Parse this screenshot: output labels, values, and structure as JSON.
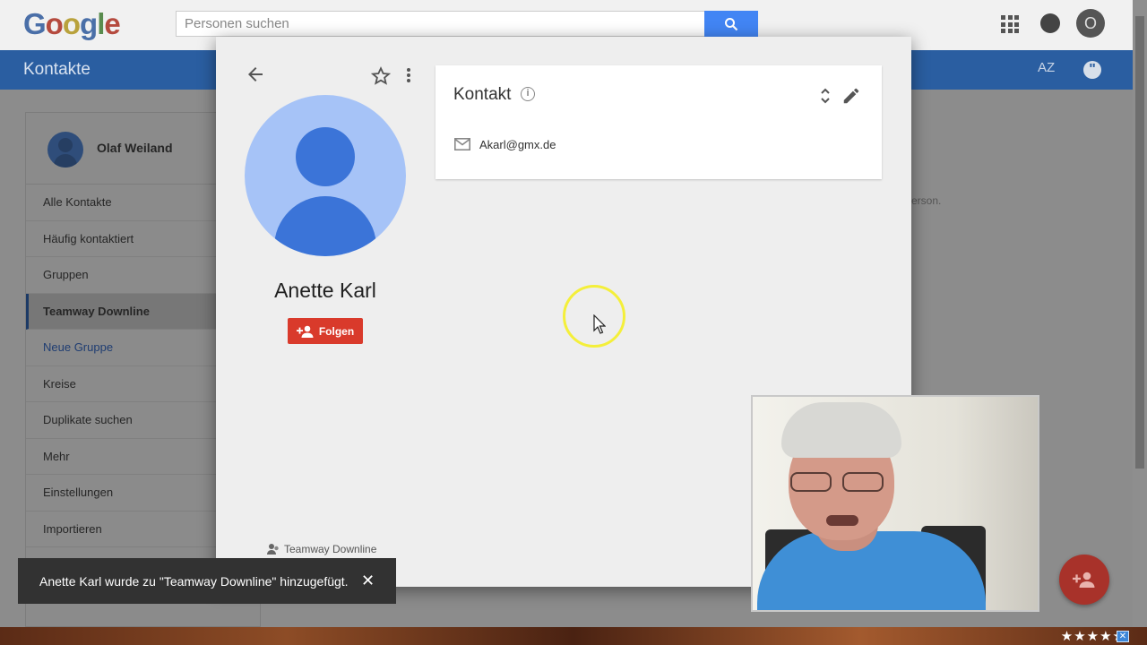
{
  "topbar": {
    "logo_letters": [
      {
        "char": "G",
        "color": "#4a6fa8"
      },
      {
        "char": "o",
        "color": "#b54a3e"
      },
      {
        "char": "o",
        "color": "#b9a23c"
      },
      {
        "char": "g",
        "color": "#4a6fa8"
      },
      {
        "char": "l",
        "color": "#5a8c4e"
      },
      {
        "char": "e",
        "color": "#b54a3e"
      }
    ],
    "search_placeholder": "Personen suchen",
    "account_initial": "O"
  },
  "app": {
    "title": "Kontakte",
    "sort_label": "AZ"
  },
  "sidebar": {
    "user_name": "Olaf Weiland",
    "items": [
      {
        "label": "Alle Kontakte"
      },
      {
        "label": "Häufig kontaktiert"
      },
      {
        "label": "Gruppen"
      },
      {
        "label": "Teamway Downline"
      },
      {
        "label": "Neue Gruppe"
      },
      {
        "label": "Kreise"
      },
      {
        "label": "Duplikate suchen"
      },
      {
        "label": "Mehr"
      },
      {
        "label": "Einstellungen"
      },
      {
        "label": "Importieren"
      }
    ]
  },
  "background_text": "erson.",
  "contact": {
    "name": "Anette Karl",
    "follow_label": "Folgen",
    "group_label": "Teamway Downline",
    "card_title": "Kontakt",
    "email": "Akarl@gmx.de"
  },
  "toast": {
    "message": "Anette Karl wurde zu \"Teamway Downline\" hinzugefügt.",
    "close_symbol": "✕"
  },
  "taskbar": {
    "rating_stars": "★★★★★",
    "tray_icon_symbol": "✕"
  },
  "colors": {
    "accent_blue": "#4285f4",
    "follow_red": "#d93a2b",
    "cursor_highlight": "#f4ef3a"
  }
}
